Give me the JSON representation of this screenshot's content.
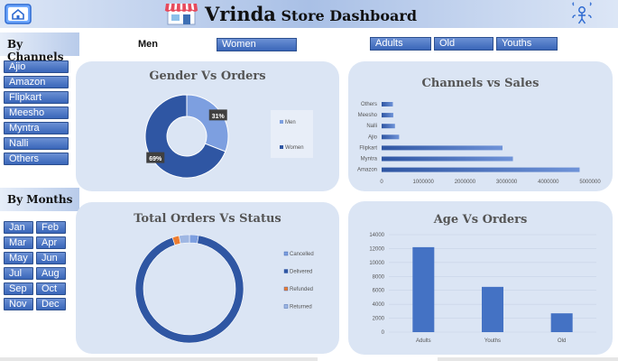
{
  "header": {
    "brand": "Vrinda",
    "title_rest": " Store Dashboard"
  },
  "segments": {
    "gender": [
      "Men",
      "Women"
    ],
    "age": [
      "Adults",
      "Old",
      "Youths"
    ]
  },
  "channels": {
    "label": "By Channels",
    "items": [
      "Ajio",
      "Amazon",
      "Flipkart",
      "Meesho",
      "Myntra",
      "Nalli",
      "Others"
    ]
  },
  "months": {
    "label": "By Months",
    "items": [
      "Jan",
      "Feb",
      "Mar",
      "Apr",
      "May",
      "Jun",
      "Jul",
      "Aug",
      "Sep",
      "Oct",
      "Nov",
      "Dec"
    ]
  },
  "panels": {
    "gender_title": "Gender Vs Orders",
    "channels_title": "Channels vs Sales",
    "status_title": "Total Orders Vs Status",
    "age_title": "Age Vs Orders"
  },
  "colors": {
    "dark_blue": "#2f56a3",
    "light_blue": "#7d9fe0",
    "bar_blue": "#4472c4",
    "orange": "#ed7d31",
    "panel_bg": "#dbe5f4"
  },
  "chart_data": [
    {
      "type": "pie",
      "title": "Gender Vs Orders",
      "categories": [
        "Men",
        "Women"
      ],
      "values": [
        31,
        69
      ],
      "labels": [
        "31%",
        "69%"
      ],
      "legend": "right"
    },
    {
      "type": "bar",
      "orientation": "horizontal",
      "title": "Channels vs Sales",
      "categories": [
        "Others",
        "Meesho",
        "Nalli",
        "Ajio",
        "Flipkart",
        "Myntra",
        "Amazon"
      ],
      "values": [
        270000,
        280000,
        320000,
        420000,
        2900000,
        3150000,
        4750000
      ],
      "xticks": [
        "0",
        "1000000",
        "2000000",
        "3000000",
        "4000000",
        "5000000"
      ],
      "xlim": [
        0,
        5000000
      ]
    },
    {
      "type": "pie",
      "title": "Total Orders Vs Status",
      "categories": [
        "Cancelled",
        "Delivered",
        "Refunded",
        "Returned"
      ],
      "values": [
        2.7,
        92.2,
        2.0,
        3.1
      ],
      "legend": "right"
    },
    {
      "type": "bar",
      "title": "Age Vs Orders",
      "categories": [
        "Adults",
        "Youths",
        "Old"
      ],
      "values": [
        12200,
        6500,
        2700
      ],
      "ylim": [
        0,
        14000
      ],
      "yticks": [
        "0",
        "2000",
        "4000",
        "6000",
        "8000",
        "10000",
        "12000",
        "14000"
      ]
    }
  ]
}
